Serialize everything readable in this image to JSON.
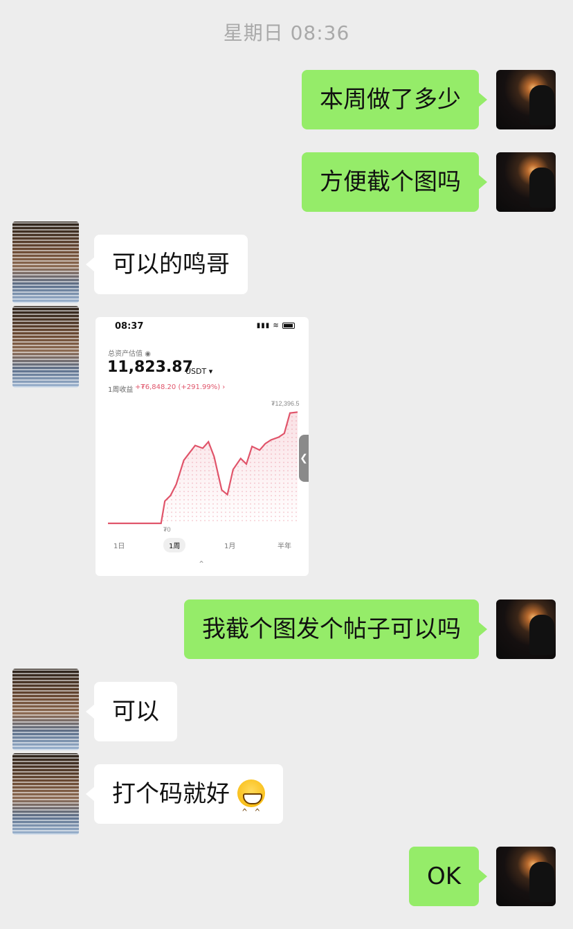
{
  "header": {
    "timestamp": "星期日 08:36"
  },
  "messages": [
    {
      "side": "right",
      "text": "本周做了多少"
    },
    {
      "side": "right",
      "text": "方便截个图吗"
    },
    {
      "side": "left",
      "text": "可以的鸣哥"
    },
    {
      "side": "left",
      "type": "image"
    },
    {
      "side": "right",
      "text": "我截个图发个帖子可以吗"
    },
    {
      "side": "left",
      "text": "可以"
    },
    {
      "side": "left",
      "text": "打个码就好",
      "emoji": "grinning-face-icon"
    },
    {
      "side": "right",
      "text": "OK"
    }
  ],
  "screenshot": {
    "time": "08:37",
    "label": "总资产估值",
    "value": "11,823.87",
    "unit": "USDT ▾",
    "pnl_label": "1周收益",
    "pnl_value": "+₮6,848.20 (+291.99%) ›",
    "high_label": "₮12,396.5",
    "low_label": "₮0",
    "tabs": [
      "1日",
      "1周",
      "1月",
      "半年"
    ],
    "active_tab": "1周",
    "handle": "❮",
    "chevron": "⌃",
    "accent": "#e0546a"
  },
  "chart_data": {
    "type": "line",
    "ylim": [
      0,
      12396.5
    ],
    "x": [
      0,
      5,
      10,
      15,
      20,
      25,
      28,
      30,
      33,
      36,
      40,
      43,
      46,
      50,
      53,
      56,
      60,
      63,
      66,
      70,
      73,
      76,
      80,
      83,
      86,
      90,
      93,
      96,
      100
    ],
    "values": [
      0,
      0,
      0,
      0,
      0,
      0,
      0,
      2400,
      3000,
      4200,
      6800,
      7600,
      8400,
      8100,
      8800,
      7200,
      3600,
      3100,
      5800,
      7000,
      6400,
      8300,
      7900,
      8600,
      9000,
      9300,
      9700,
      11900,
      12000
    ]
  }
}
